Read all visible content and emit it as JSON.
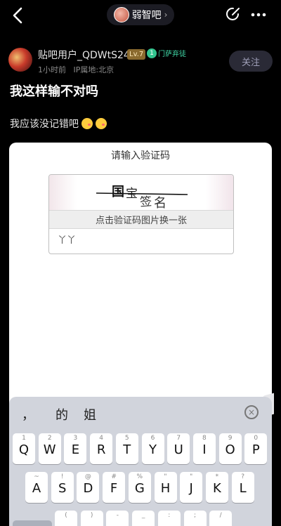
{
  "header": {
    "forum_name": "弱智吧",
    "forum_arrow": "›"
  },
  "post": {
    "username": "贴吧用户_QDWtS24",
    "level": "Lv.7",
    "medal_number": "1",
    "medal_label": "门萨弃徒",
    "time": "1小时前",
    "location": "IP属地:北京",
    "follow_label": "关注",
    "title": "我这样输不对吗",
    "body": "我应该没记错吧"
  },
  "captcha_dialog": {
    "title": "请输入验证码",
    "captcha_chars": [
      "国",
      "宝",
      "签",
      "名"
    ],
    "refresh_label": "点击验证码图片换一张",
    "input_value": "丫丫"
  },
  "keyboard": {
    "candidates": [
      "，",
      "的",
      "姐"
    ],
    "close_symbol": "×",
    "row1": [
      {
        "main": "Q",
        "sub": "1"
      },
      {
        "main": "W",
        "sub": "2"
      },
      {
        "main": "E",
        "sub": "3"
      },
      {
        "main": "R",
        "sub": "4"
      },
      {
        "main": "T",
        "sub": "5"
      },
      {
        "main": "Y",
        "sub": "6"
      },
      {
        "main": "U",
        "sub": "7"
      },
      {
        "main": "I",
        "sub": "8"
      },
      {
        "main": "O",
        "sub": "9"
      },
      {
        "main": "P",
        "sub": "0"
      }
    ],
    "row2": [
      {
        "main": "A",
        "sub": "~"
      },
      {
        "main": "S",
        "sub": "!"
      },
      {
        "main": "D",
        "sub": "@"
      },
      {
        "main": "F",
        "sub": "#"
      },
      {
        "main": "G",
        "sub": "%"
      },
      {
        "main": "H",
        "sub": "\""
      },
      {
        "main": "J",
        "sub": "\""
      },
      {
        "main": "K",
        "sub": "*"
      },
      {
        "main": "L",
        "sub": "?"
      }
    ],
    "row3_left_label": "分词",
    "row3_subs": [
      "(",
      ")",
      "-",
      "_",
      ":",
      ";",
      "/"
    ],
    "edge_tab_label": "S"
  }
}
